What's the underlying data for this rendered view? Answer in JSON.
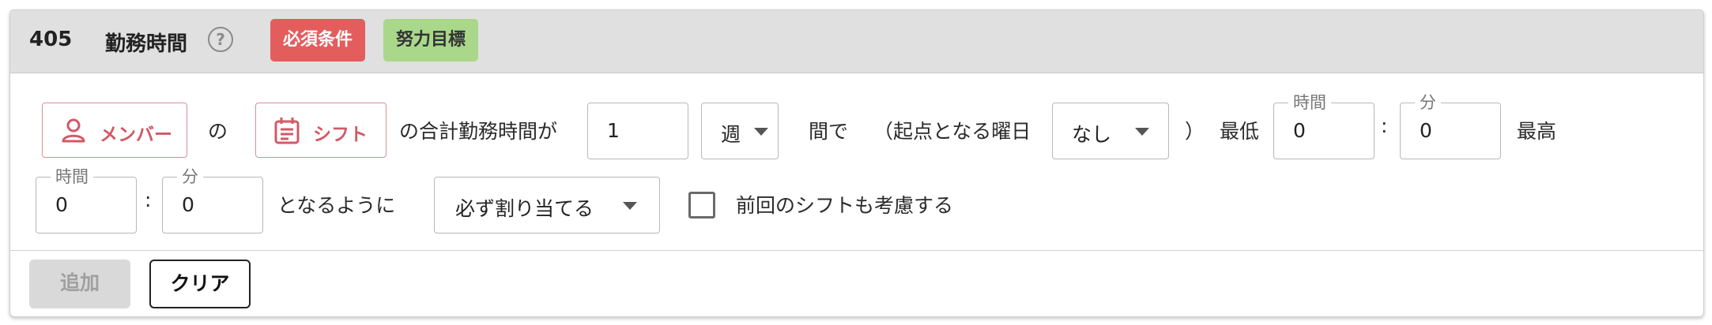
{
  "header": {
    "id": "405",
    "title": "勤務時間",
    "help_glyph": "?",
    "tags": [
      {
        "label": "必須条件",
        "color": "#e35d5d"
      },
      {
        "label": "努力目標",
        "color": "#a9d88a"
      }
    ]
  },
  "rule": {
    "member_chip": {
      "label": "メンバー",
      "icon": "person-icon"
    },
    "particle_no": "の",
    "shift_chip": {
      "label": "シフト",
      "icon": "calendar-icon"
    },
    "text_total": "の合計勤務時間が",
    "period_count": "1",
    "period_unit": "週",
    "text_between": "間で",
    "text_start_day": "（起点となる曜日",
    "start_day_value": "なし",
    "text_close_paren": "）",
    "text_min": "最低",
    "min_hours": {
      "legend": "時間",
      "value": "0"
    },
    "colon": ":",
    "min_minutes": {
      "legend": "分",
      "value": "0"
    },
    "text_max": "最高",
    "max_hours": {
      "legend": "時間",
      "value": "0"
    },
    "max_minutes": {
      "legend": "分",
      "value": "0"
    },
    "text_so_that": "となるように",
    "assign_mode": "必ず割り当てる",
    "consider_previous_label": "前回のシフトも考慮する",
    "consider_previous_checked": false
  },
  "footer": {
    "add_label": "追加",
    "clear_label": "クリア"
  },
  "colors": {
    "accent_red": "#d05a66",
    "required_tag": "#e35d5d",
    "effort_tag": "#a9d88a"
  }
}
